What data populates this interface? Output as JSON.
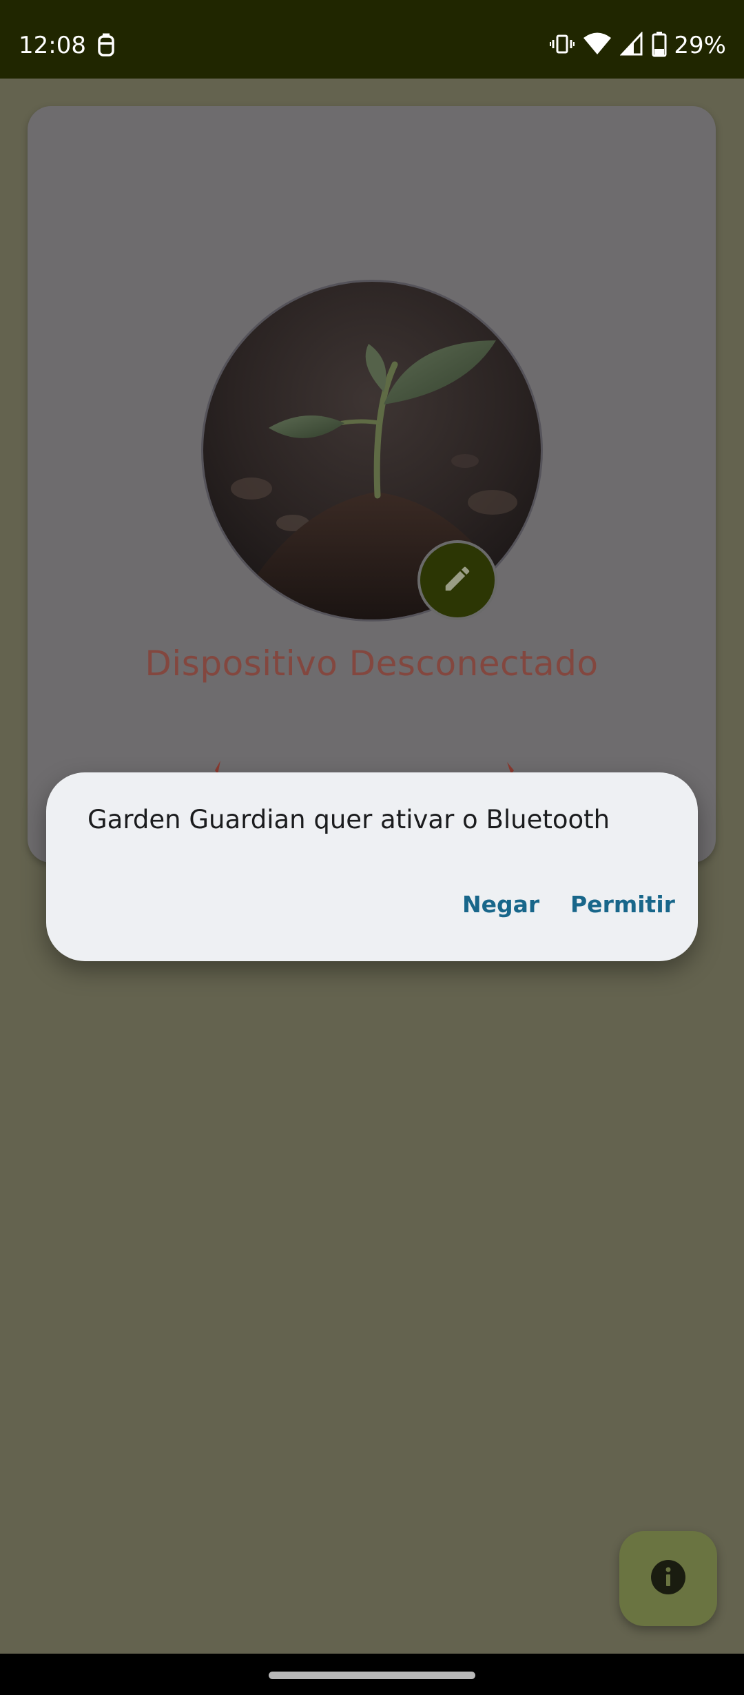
{
  "status_bar": {
    "time": "12:08",
    "notification_icon": "clipboard-icon",
    "vibrate_icon": "vibrate-icon",
    "wifi_icon": "wifi-icon",
    "signal_icon": "signal-icon",
    "battery_icon": "battery-icon",
    "battery_percent": "29%"
  },
  "card": {
    "image": "seedling-in-soil-photo",
    "edit_icon": "pencil-icon",
    "status_text": "Dispositivo Desconectado"
  },
  "dialog": {
    "message": "Garden Guardian quer ativar o Bluetooth",
    "deny_label": "Negar",
    "allow_label": "Permitir"
  },
  "fab": {
    "icon": "info-icon"
  },
  "colors": {
    "status_bar_bg": "#202600",
    "scrim_bg": "#64634f",
    "status_text_color": "#83473f",
    "dialog_button_color": "#18668a",
    "fab_bg": "#6a7441"
  }
}
